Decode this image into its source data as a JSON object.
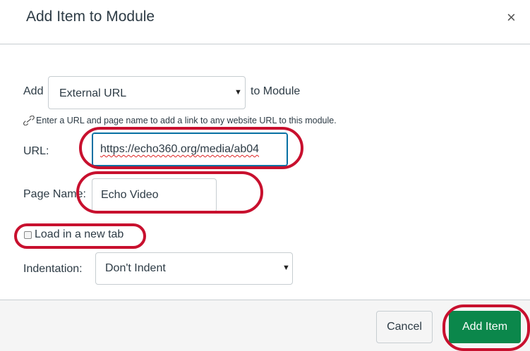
{
  "dialog": {
    "title": "Add Item to Module",
    "close_glyph": "×"
  },
  "form": {
    "add_label": "Add",
    "item_type": "External URL",
    "to_module_label": "to Module",
    "hint_text": "Enter a URL and page name to add a link to any website URL to this module.",
    "url_label": "URL:",
    "url_value": "https://echo360.org/media/ab04",
    "page_name_label": "Page Name:",
    "page_name_value": "Echo Video",
    "new_tab_label": "Load in a new tab",
    "indentation_label": "Indentation:",
    "indentation_value": "Don't Indent"
  },
  "footer": {
    "cancel_label": "Cancel",
    "add_label": "Add Item"
  },
  "icons": {
    "link": "link-icon",
    "caret": "caret-down-icon",
    "close": "close-icon"
  },
  "colors": {
    "primary_button": "#0b874b",
    "annotation": "#c8102e",
    "focus": "#0770a3"
  }
}
